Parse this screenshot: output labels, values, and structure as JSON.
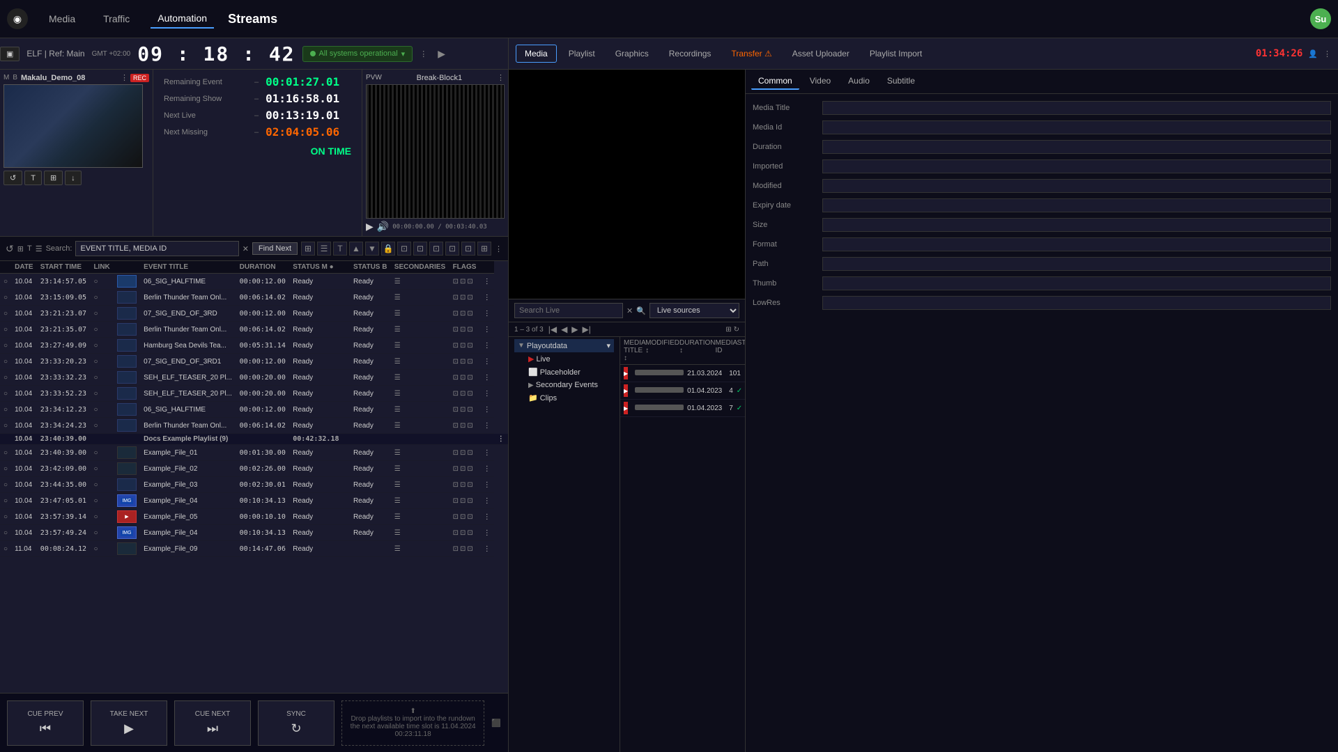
{
  "nav": {
    "logo": "◉",
    "items": [
      {
        "label": "Media",
        "active": false
      },
      {
        "label": "Traffic",
        "active": false
      },
      {
        "label": "Automation",
        "active": true
      },
      {
        "label": "Streams",
        "active": false
      }
    ],
    "avatar": "Su",
    "avatar_color": "#4CAF50"
  },
  "toolbar": {
    "channel_label": "ELF | Ref: Main",
    "gmt": "GMT +02:00",
    "time": "09 : 18 : 42",
    "status": "All systems operational",
    "forward_arrow": "▶"
  },
  "right_toolbar": {
    "tabs": [
      "Media",
      "Playlist",
      "Graphics",
      "Recordings",
      "Transfer",
      "Asset Uploader",
      "Playlist Import"
    ],
    "active_tab": "Media",
    "alert_tab": "Transfer",
    "time_red": "01:34:26"
  },
  "timers": {
    "remaining_event_label": "Remaining Event",
    "remaining_event": "00:01:27.01",
    "remaining_show_label": "Remaining Show",
    "remaining_show": "01:16:58.01",
    "next_live_label": "Next Live",
    "next_live": "00:13:19.01",
    "next_missing_label": "Next Missing",
    "next_missing": "02:04:05.06",
    "on_time": "ON TIME"
  },
  "pvw": {
    "label": "PVW",
    "title": "Break-Block1",
    "timecode": "00:00:00.00 / 00:03:40.03"
  },
  "preview": {
    "title": "Makalu_Demo_08",
    "rec": "REC"
  },
  "search": {
    "label": "Search:",
    "placeholder": "EVENT TITLE, MEDIA ID",
    "find_next": "Find Next"
  },
  "table": {
    "headers": [
      "",
      "",
      "START TIME",
      "LINK",
      "",
      "EVENT TITLE",
      "DURATION",
      "STATUS M",
      "",
      "STATUS B",
      "SECONDARIES",
      "FLAGS",
      ""
    ],
    "rows": [
      {
        "date": "10.04",
        "time": "23:14:57.05",
        "link": "",
        "thumb": "blue",
        "title": "06_SIG_HALFTIME",
        "duration": "00:00:12.00",
        "status_m": "Ready",
        "status_b": "Ready",
        "flags": "icons"
      },
      {
        "date": "10.04",
        "time": "23:15:09.05",
        "link": "",
        "thumb": "dark",
        "title": "Berlin Thunder Team Onl...",
        "duration": "00:06:14.02",
        "status_m": "Ready",
        "status_b": "Ready",
        "flags": "icons"
      },
      {
        "date": "10.04",
        "time": "23:21:23.07",
        "link": "",
        "thumb": "dark",
        "title": "07_SIG_END_OF_3RD",
        "duration": "00:00:12.00",
        "status_m": "Ready",
        "status_b": "Ready",
        "flags": "icons"
      },
      {
        "date": "10.04",
        "time": "23:21:35.07",
        "link": "",
        "thumb": "dark",
        "title": "Berlin Thunder Team Onl...",
        "duration": "00:06:14.02",
        "status_m": "Ready",
        "status_b": "Ready",
        "flags": "icons"
      },
      {
        "date": "10.04",
        "time": "23:27:49.09",
        "link": "",
        "thumb": "dark",
        "title": "Hamburg Sea Devils Tea...",
        "duration": "00:05:31.14",
        "status_m": "Ready",
        "status_b": "Ready",
        "flags": "icons"
      },
      {
        "date": "10.04",
        "time": "23:33:20.23",
        "link": "",
        "thumb": "dark",
        "title": "07_SIG_END_OF_3RD1",
        "duration": "00:00:12.00",
        "status_m": "Ready",
        "status_b": "Ready",
        "flags": "icons"
      },
      {
        "date": "10.04",
        "time": "23:33:32.23",
        "link": "",
        "thumb": "dark",
        "title": "SEH_ELF_TEASER_20 Pl...",
        "duration": "00:00:20.00",
        "status_m": "Ready",
        "status_b": "Ready",
        "flags": "icons"
      },
      {
        "date": "10.04",
        "time": "23:33:52.23",
        "link": "",
        "thumb": "dark",
        "title": "SEH_ELF_TEASER_20 Pl...",
        "duration": "00:00:20.00",
        "status_m": "Ready",
        "status_b": "Ready",
        "flags": "icons"
      },
      {
        "date": "10.04",
        "time": "23:34:12.23",
        "link": "",
        "thumb": "dark",
        "title": "06_SIG_HALFTIME",
        "duration": "00:00:12.00",
        "status_m": "Ready",
        "status_b": "Ready",
        "flags": "icons"
      },
      {
        "date": "10.04",
        "time": "23:34:24.23",
        "link": "",
        "thumb": "dark",
        "title": "Berlin Thunder Team Onl...",
        "duration": "00:06:14.02",
        "status_m": "Ready",
        "status_b": "Ready",
        "flags": "icons"
      },
      {
        "date": "10.04",
        "time": "23:40:39.00",
        "group": true,
        "title": "Docs Example Playlist (9)",
        "duration": "00:42:32.18"
      },
      {
        "date": "10.04",
        "time": "23:40:39.00",
        "link": "",
        "thumb": "empty",
        "title": "Example_File_01",
        "duration": "00:01:30.00",
        "status_m": "Ready",
        "status_b": "Ready",
        "flags": "icons"
      },
      {
        "date": "10.04",
        "time": "23:42:09.00",
        "link": "",
        "thumb": "empty",
        "title": "Example_File_02",
        "duration": "00:02:26.00",
        "status_m": "Ready",
        "status_b": "Ready",
        "flags": "icons"
      },
      {
        "date": "10.04",
        "time": "23:44:35.00",
        "link": "",
        "thumb": "dark",
        "title": "Example_File_03",
        "duration": "00:02:30.01",
        "status_m": "Ready",
        "status_b": "Ready",
        "flags": "icons"
      },
      {
        "date": "10.04",
        "time": "23:47:05.01",
        "link": "",
        "thumb": "blue_badge",
        "title": "Example_File_04",
        "duration": "00:10:34.13",
        "status_m": "Ready",
        "status_b": "Ready",
        "flags": "icons"
      },
      {
        "date": "10.04",
        "time": "23:57:39.14",
        "link": "",
        "thumb": "red_badge",
        "title": "Example_File_05",
        "duration": "00:00:10.10",
        "status_m": "Ready",
        "status_b": "Ready",
        "flags": "icons"
      },
      {
        "date": "10.04",
        "time": "23:57:49.24",
        "link": "",
        "thumb": "blue_badge2",
        "title": "Example_File_04",
        "duration": "00:10:34.13",
        "status_m": "Ready",
        "status_b": "Ready",
        "flags": "icons"
      },
      {
        "date": "11.04",
        "time": "00:08:24.12",
        "link": "",
        "thumb": "empty",
        "title": "Example_File_09",
        "duration": "00:14:47.06",
        "status_m": "Ready",
        "status_b": "",
        "flags": "icons"
      }
    ]
  },
  "bottom_buttons": [
    {
      "label": "CUE PREV",
      "icon": "⏮"
    },
    {
      "label": "TAKE NEXT",
      "icon": "▶"
    },
    {
      "label": "CUE NEXT",
      "icon": "⏭"
    },
    {
      "label": "SYNC",
      "icon": "↻"
    }
  ],
  "drop_zone": {
    "icon": "⬆",
    "line1": "Drop playlists to import into the rundown",
    "line2": "the next available time slot is 11.04.2024 00:23:11.18"
  },
  "live_sources": {
    "search_placeholder": "Search Live",
    "source_label": "Live sources",
    "page_range": "1 – 3 of 3",
    "tree_items": [
      {
        "label": "Playoutdata",
        "arrow": "▼",
        "selected": true
      },
      {
        "label": "Live",
        "icon": "▶",
        "indent": true,
        "selected": false
      },
      {
        "label": "Placeholder",
        "icon": "⬜",
        "indent": true,
        "selected": false
      },
      {
        "label": "Secondary Events",
        "arrow": "▶",
        "indent": true,
        "selected": false
      },
      {
        "label": "Clips",
        "icon": "📁",
        "indent": true,
        "selected": false
      }
    ],
    "media_columns": [
      "MEDIA TITLE",
      "MODIFIED",
      "DURATION",
      "MEDIA ID",
      "STATUS"
    ],
    "media_rows": [
      {
        "thumb": "red",
        "title": "████ ██ ████",
        "modified": "21.03.2024",
        "duration": "",
        "media_id": "101",
        "status": "✓"
      },
      {
        "thumb": "red",
        "title": "████ ████ ███",
        "modified": "01.04.2023",
        "duration": "",
        "media_id": "4",
        "status": "✓"
      },
      {
        "thumb": "red",
        "title": "████ ████ ███",
        "modified": "01.04.2023",
        "duration": "",
        "media_id": "7",
        "status": "✓"
      }
    ]
  },
  "properties": {
    "tabs": [
      "Common",
      "Video",
      "Audio",
      "Subtitle"
    ],
    "active_tab": "Common",
    "fields": [
      {
        "label": "Media Title",
        "value": ""
      },
      {
        "label": "Media Id",
        "value": ""
      },
      {
        "label": "Duration",
        "value": ""
      },
      {
        "label": "Imported",
        "value": ""
      },
      {
        "label": "Modified",
        "value": ""
      },
      {
        "label": "Expiry date",
        "value": ""
      },
      {
        "label": "Size",
        "value": ""
      },
      {
        "label": "Format",
        "value": ""
      },
      {
        "label": "Path",
        "value": ""
      },
      {
        "label": "Thumb",
        "value": ""
      },
      {
        "label": "LowRes",
        "value": ""
      }
    ]
  }
}
